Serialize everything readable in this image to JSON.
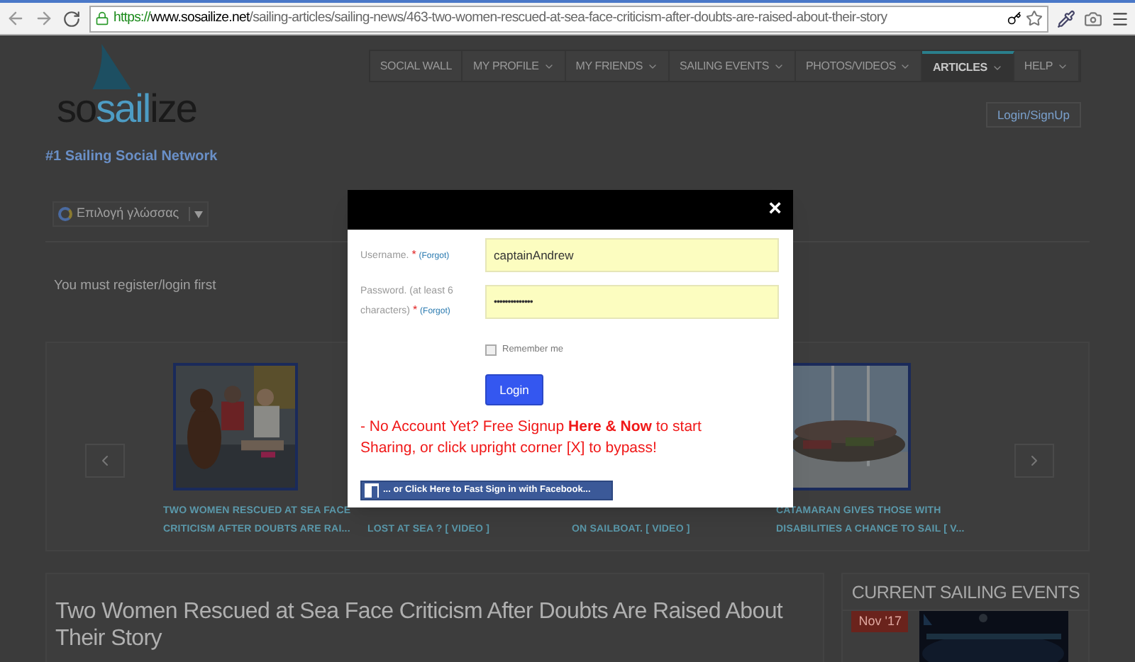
{
  "browser": {
    "url_scheme": "https://",
    "url_domain": "www.sosailize.net",
    "url_path": "/sailing-articles/sailing-news/463-two-women-rescued-at-sea-face-criticism-after-doubts-are-raised-about-their-story"
  },
  "logo": {
    "parts": [
      "so",
      "sail",
      "ize"
    ],
    "tagline": "#1 Sailing Social Network"
  },
  "nav": [
    {
      "label": "SOCIAL WALL",
      "dropdown": false,
      "selected": false
    },
    {
      "label": "MY PROFILE",
      "dropdown": true,
      "selected": false
    },
    {
      "label": "MY FRIENDS",
      "dropdown": true,
      "selected": false
    },
    {
      "label": "SAILING EVENTS",
      "dropdown": true,
      "selected": false
    },
    {
      "label": "PHOTOS/VIDEOS",
      "dropdown": true,
      "selected": false
    },
    {
      "label": "ARTICLES",
      "dropdown": true,
      "selected": true
    },
    {
      "label": "HELP",
      "dropdown": true,
      "selected": false
    }
  ],
  "login_signup": "Login/SignUp",
  "language_select": "Επιλογή γλώσσας",
  "notice": "You must register/login first",
  "slider": [
    {
      "caption": "TWO WOMEN RESCUED AT SEA FACE CRITICISM AFTER DOUBTS ARE RAI..."
    },
    {
      "caption": "LOST AT SEA ? [ VIDEO ]"
    },
    {
      "caption": "ON SAILBOAT. [ VIDEO ]"
    },
    {
      "caption": "CATAMARAN GIVES THOSE WITH DISABILITIES A CHANCE TO SAIL [ V..."
    }
  ],
  "article_title": "Two Women Rescued at Sea Face Criticism After Doubts Are Raised About Their Story",
  "sidebar": {
    "heading": "CURRENT SAILING EVENTS",
    "event_date": "Nov '17"
  },
  "modal": {
    "close": "×",
    "username": {
      "label": "Username.",
      "required": "*",
      "forgot": "(Forgot)",
      "value": "captainAndrew"
    },
    "password": {
      "label": "Password. (at least 6 characters)",
      "required": "*",
      "forgot": "(Forgot)",
      "value": "••••••••••••••"
    },
    "remember": {
      "label": "Remember me",
      "checked": false
    },
    "login": "Login",
    "signup_message": "- No Account Yet? Free Signup **Here & Now** to start Sharing, or click upright corner [X] to bypass!",
    "facebook": "... or Click Here to Fast Sign in with Facebook..."
  }
}
